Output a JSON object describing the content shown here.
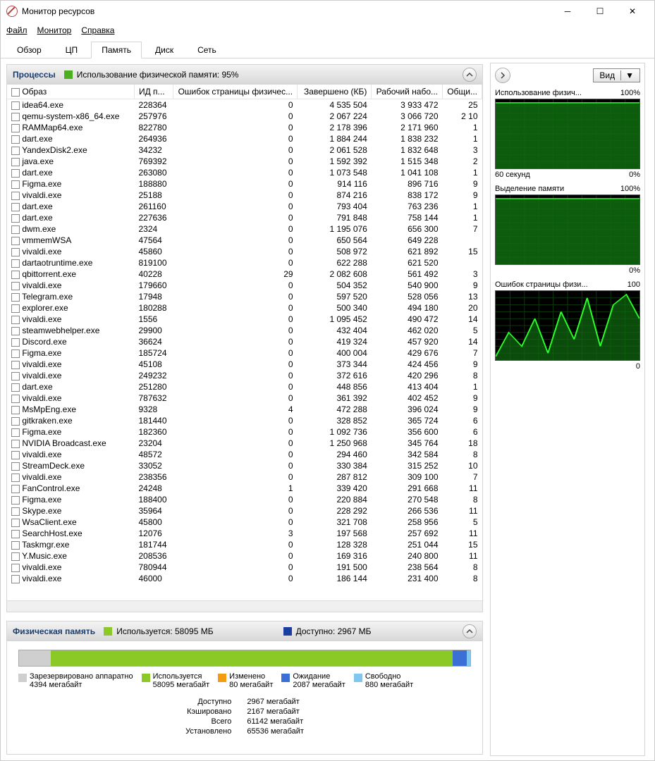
{
  "window": {
    "title": "Монитор ресурсов"
  },
  "menu": {
    "file": "Файл",
    "monitor": "Монитор",
    "help": "Справка"
  },
  "tabs": {
    "overview": "Обзор",
    "cpu": "ЦП",
    "memory": "Память",
    "disk": "Диск",
    "network": "Сеть"
  },
  "processes": {
    "title": "Процессы",
    "status_label": "Использование физической памяти: 95%",
    "status_color": "#4caf1f",
    "columns": {
      "image": "Образ",
      "pid": "ИД п...",
      "faults": "Ошибок страницы физичес...",
      "commit": "Завершено (КБ)",
      "ws": "Рабочий набо...",
      "shared": "Общи..."
    },
    "rows": [
      {
        "image": "idea64.exe",
        "pid": "228364",
        "faults": "0",
        "commit": "4 535 504",
        "ws": "3 933 472",
        "shared": "25"
      },
      {
        "image": "qemu-system-x86_64.exe",
        "pid": "257976",
        "faults": "0",
        "commit": "2 067 224",
        "ws": "3 066 720",
        "shared": "2 10"
      },
      {
        "image": "RAMMap64.exe",
        "pid": "822780",
        "faults": "0",
        "commit": "2 178 396",
        "ws": "2 171 960",
        "shared": "1"
      },
      {
        "image": "dart.exe",
        "pid": "264936",
        "faults": "0",
        "commit": "1 884 244",
        "ws": "1 838 232",
        "shared": "1"
      },
      {
        "image": "YandexDisk2.exe",
        "pid": "34232",
        "faults": "0",
        "commit": "2 061 528",
        "ws": "1 832 648",
        "shared": "3"
      },
      {
        "image": "java.exe",
        "pid": "769392",
        "faults": "0",
        "commit": "1 592 392",
        "ws": "1 515 348",
        "shared": "2"
      },
      {
        "image": "dart.exe",
        "pid": "263080",
        "faults": "0",
        "commit": "1 073 548",
        "ws": "1 041 108",
        "shared": "1"
      },
      {
        "image": "Figma.exe",
        "pid": "188880",
        "faults": "0",
        "commit": "914 116",
        "ws": "896 716",
        "shared": "9"
      },
      {
        "image": "vivaldi.exe",
        "pid": "25188",
        "faults": "0",
        "commit": "874 216",
        "ws": "838 172",
        "shared": "9"
      },
      {
        "image": "dart.exe",
        "pid": "261160",
        "faults": "0",
        "commit": "793 404",
        "ws": "763 236",
        "shared": "1"
      },
      {
        "image": "dart.exe",
        "pid": "227636",
        "faults": "0",
        "commit": "791 848",
        "ws": "758 144",
        "shared": "1"
      },
      {
        "image": "dwm.exe",
        "pid": "2324",
        "faults": "0",
        "commit": "1 195 076",
        "ws": "656 300",
        "shared": "7"
      },
      {
        "image": "vmmemWSA",
        "pid": "47564",
        "faults": "0",
        "commit": "650 564",
        "ws": "649 228",
        "shared": ""
      },
      {
        "image": "vivaldi.exe",
        "pid": "45860",
        "faults": "0",
        "commit": "508 972",
        "ws": "621 892",
        "shared": "15"
      },
      {
        "image": "dartaotruntime.exe",
        "pid": "819100",
        "faults": "0",
        "commit": "622 288",
        "ws": "621 520",
        "shared": ""
      },
      {
        "image": "qbittorrent.exe",
        "pid": "40228",
        "faults": "29",
        "commit": "2 082 608",
        "ws": "561 492",
        "shared": "3"
      },
      {
        "image": "vivaldi.exe",
        "pid": "179660",
        "faults": "0",
        "commit": "504 352",
        "ws": "540 900",
        "shared": "9"
      },
      {
        "image": "Telegram.exe",
        "pid": "17948",
        "faults": "0",
        "commit": "597 520",
        "ws": "528 056",
        "shared": "13"
      },
      {
        "image": "explorer.exe",
        "pid": "180288",
        "faults": "0",
        "commit": "500 340",
        "ws": "494 180",
        "shared": "20"
      },
      {
        "image": "vivaldi.exe",
        "pid": "1556",
        "faults": "0",
        "commit": "1 095 452",
        "ws": "490 472",
        "shared": "14"
      },
      {
        "image": "steamwebhelper.exe",
        "pid": "29900",
        "faults": "0",
        "commit": "432 404",
        "ws": "462 020",
        "shared": "5"
      },
      {
        "image": "Discord.exe",
        "pid": "36624",
        "faults": "0",
        "commit": "419 324",
        "ws": "457 920",
        "shared": "14"
      },
      {
        "image": "Figma.exe",
        "pid": "185724",
        "faults": "0",
        "commit": "400 004",
        "ws": "429 676",
        "shared": "7"
      },
      {
        "image": "vivaldi.exe",
        "pid": "45108",
        "faults": "0",
        "commit": "373 344",
        "ws": "424 456",
        "shared": "9"
      },
      {
        "image": "vivaldi.exe",
        "pid": "249232",
        "faults": "0",
        "commit": "372 616",
        "ws": "420 296",
        "shared": "8"
      },
      {
        "image": "dart.exe",
        "pid": "251280",
        "faults": "0",
        "commit": "448 856",
        "ws": "413 404",
        "shared": "1"
      },
      {
        "image": "vivaldi.exe",
        "pid": "787632",
        "faults": "0",
        "commit": "361 392",
        "ws": "402 452",
        "shared": "9"
      },
      {
        "image": "MsMpEng.exe",
        "pid": "9328",
        "faults": "4",
        "commit": "472 288",
        "ws": "396 024",
        "shared": "9"
      },
      {
        "image": "gitkraken.exe",
        "pid": "181440",
        "faults": "0",
        "commit": "328 852",
        "ws": "365 724",
        "shared": "6"
      },
      {
        "image": "Figma.exe",
        "pid": "182360",
        "faults": "0",
        "commit": "1 092 736",
        "ws": "356 600",
        "shared": "6"
      },
      {
        "image": "NVIDIA Broadcast.exe",
        "pid": "23204",
        "faults": "0",
        "commit": "1 250 968",
        "ws": "345 764",
        "shared": "18"
      },
      {
        "image": "vivaldi.exe",
        "pid": "48572",
        "faults": "0",
        "commit": "294 460",
        "ws": "342 584",
        "shared": "8"
      },
      {
        "image": "StreamDeck.exe",
        "pid": "33052",
        "faults": "0",
        "commit": "330 384",
        "ws": "315 252",
        "shared": "10"
      },
      {
        "image": "vivaldi.exe",
        "pid": "238356",
        "faults": "0",
        "commit": "287 812",
        "ws": "309 100",
        "shared": "7"
      },
      {
        "image": "FanControl.exe",
        "pid": "24248",
        "faults": "1",
        "commit": "339 420",
        "ws": "291 668",
        "shared": "11"
      },
      {
        "image": "Figma.exe",
        "pid": "188400",
        "faults": "0",
        "commit": "220 884",
        "ws": "270 548",
        "shared": "8"
      },
      {
        "image": "Skype.exe",
        "pid": "35964",
        "faults": "0",
        "commit": "228 292",
        "ws": "266 536",
        "shared": "11"
      },
      {
        "image": "WsaClient.exe",
        "pid": "45800",
        "faults": "0",
        "commit": "321 708",
        "ws": "258 956",
        "shared": "5"
      },
      {
        "image": "SearchHost.exe",
        "pid": "12076",
        "faults": "3",
        "commit": "197 568",
        "ws": "257 692",
        "shared": "11"
      },
      {
        "image": "Taskmgr.exe",
        "pid": "181744",
        "faults": "0",
        "commit": "128 328",
        "ws": "251 044",
        "shared": "15"
      },
      {
        "image": "Y.Music.exe",
        "pid": "208536",
        "faults": "0",
        "commit": "169 316",
        "ws": "240 800",
        "shared": "11"
      },
      {
        "image": "vivaldi.exe",
        "pid": "780944",
        "faults": "0",
        "commit": "191 500",
        "ws": "238 564",
        "shared": "8"
      },
      {
        "image": "vivaldi.exe",
        "pid": "46000",
        "faults": "0",
        "commit": "186 144",
        "ws": "231 400",
        "shared": "8"
      }
    ]
  },
  "physmem": {
    "title": "Физическая память",
    "used_label": "Используется: 58095 МБ",
    "used_color": "#8ac926",
    "avail_label": "Доступно: 2967 МБ",
    "avail_color": "#1a3ea0",
    "bar": [
      {
        "label": "reserved",
        "pct": 7,
        "color": "#cfcfcf"
      },
      {
        "label": "used",
        "pct": 89,
        "color": "#8ac926"
      },
      {
        "label": "modified",
        "pct": 0.1,
        "color": "#f39c12"
      },
      {
        "label": "standby",
        "pct": 3.2,
        "color": "#3b6fd6"
      },
      {
        "label": "free",
        "pct": 0.7,
        "color": "#7fc6f0"
      }
    ],
    "legend": [
      {
        "color": "#cfcfcf",
        "name": "Зарезервировано аппаратно",
        "val": "4394 мегабайт"
      },
      {
        "color": "#8ac926",
        "name": "Используется",
        "val": "58095 мегабайт"
      },
      {
        "color": "#f39c12",
        "name": "Изменено",
        "val": "80 мегабайт"
      },
      {
        "color": "#3b6fd6",
        "name": "Ожидание",
        "val": "2087 мегабайт"
      },
      {
        "color": "#7fc6f0",
        "name": "Свободно",
        "val": "880 мегабайт"
      }
    ],
    "stats": [
      {
        "k": "Доступно",
        "v": "2967 мегабайт"
      },
      {
        "k": "Кэшировано",
        "v": "2167 мегабайт"
      },
      {
        "k": "Всего",
        "v": "61142 мегабайт"
      },
      {
        "k": "Установлено",
        "v": "65536 мегабайт"
      }
    ]
  },
  "right": {
    "view_label": "Вид",
    "graphs": [
      {
        "title": "Использование физич...",
        "max": "100%",
        "footer_left": "60 секунд",
        "footer_right": "0%",
        "fill": "high"
      },
      {
        "title": "Выделение памяти",
        "max": "100%",
        "footer_left": "",
        "footer_right": "0%",
        "fill": "high"
      },
      {
        "title": "Ошибок страницы физи...",
        "max": "100",
        "footer_left": "",
        "footer_right": "0",
        "fill": "spiky"
      }
    ]
  },
  "chart_data": [
    {
      "type": "area",
      "title": "Использование физической памяти (%)",
      "xlabel": "60 секунд",
      "ylabel": "%",
      "ylim": [
        0,
        100
      ],
      "series": [
        {
          "name": "used",
          "values": [
            95,
            95,
            95,
            95,
            95,
            95,
            95,
            95,
            95,
            95,
            95,
            95
          ]
        }
      ]
    },
    {
      "type": "area",
      "title": "Выделение памяти (%)",
      "ylabel": "%",
      "ylim": [
        0,
        100
      ],
      "series": [
        {
          "name": "commit",
          "values": [
            96,
            96,
            96,
            96,
            96,
            96,
            96,
            96,
            96,
            96,
            96,
            96
          ]
        }
      ]
    },
    {
      "type": "area",
      "title": "Ошибок страницы физической памяти/с",
      "ylim": [
        0,
        100
      ],
      "series": [
        {
          "name": "faults",
          "values": [
            5,
            40,
            20,
            60,
            10,
            70,
            30,
            90,
            20,
            80,
            95,
            60
          ]
        }
      ]
    }
  ]
}
